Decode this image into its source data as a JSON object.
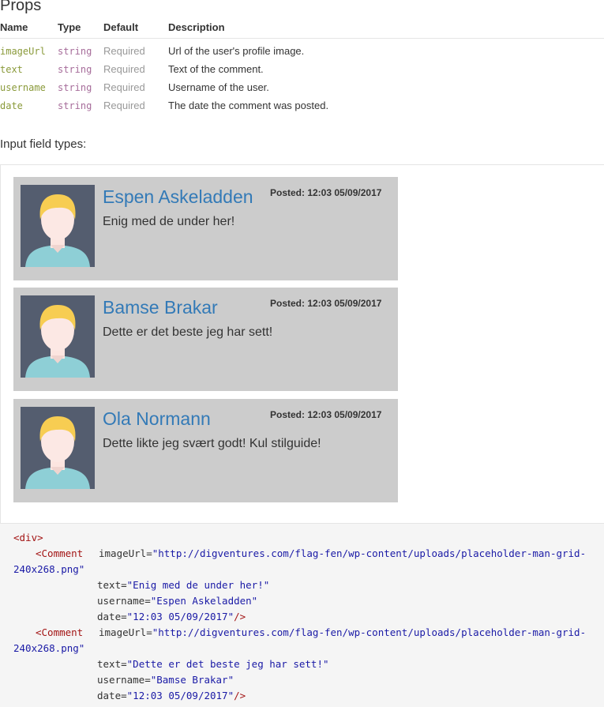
{
  "props": {
    "title": "Props",
    "headers": {
      "name": "Name",
      "type": "Type",
      "default": "Default",
      "description": "Description"
    },
    "rows": [
      {
        "name": "imageUrl",
        "type": "string",
        "default": "Required",
        "description": "Url of the user's profile image."
      },
      {
        "name": "text",
        "type": "string",
        "default": "Required",
        "description": "Text of the comment."
      },
      {
        "name": "username",
        "type": "string",
        "default": "Required",
        "description": "Username of the user."
      },
      {
        "name": "date",
        "type": "string",
        "default": "Required",
        "description": "The date the comment was posted."
      }
    ]
  },
  "examples": {
    "label": "Input field types:",
    "comments": [
      {
        "username": "Espen Askeladden",
        "date": "Posted: 12:03 05/09/2017",
        "text": "Enig med de under her!"
      },
      {
        "username": "Bamse Brakar",
        "date": "Posted: 12:03 05/09/2017",
        "text": "Dette er det beste jeg har sett!"
      },
      {
        "username": "Ola Normann",
        "date": "Posted: 12:03 05/09/2017",
        "text": "Dette likte jeg svært godt! Kul stilguide!"
      }
    ]
  },
  "code": {
    "open_div": "<div>",
    "comment_tag": "<Comment",
    "blocks": [
      {
        "image_attr": "imageUrl=",
        "image_val_1": "\"http://digventures.com/flag-fen/wp-content/uploads/placeholder-man-grid-",
        "image_val_2": "240x268.png\"",
        "text_attr": "text=",
        "text_val": "\"Enig med de under her!\"",
        "username_attr": "username=",
        "username_val": "\"Espen Askeladden\"",
        "date_attr": "date=",
        "date_val": "\"12:03 05/09/2017\"",
        "close": "/>"
      },
      {
        "image_attr": "imageUrl=",
        "image_val_1": "\"http://digventures.com/flag-fen/wp-content/uploads/placeholder-man-grid-",
        "image_val_2": "240x268.png\"",
        "text_attr": "text=",
        "text_val": "\"Dette er det beste jeg har sett!\"",
        "username_attr": "username=",
        "username_val": "\"Bamse Brakar\"",
        "date_attr": "date=",
        "date_val": "\"12:03 05/09/2017\"",
        "close": "/>"
      }
    ]
  }
}
